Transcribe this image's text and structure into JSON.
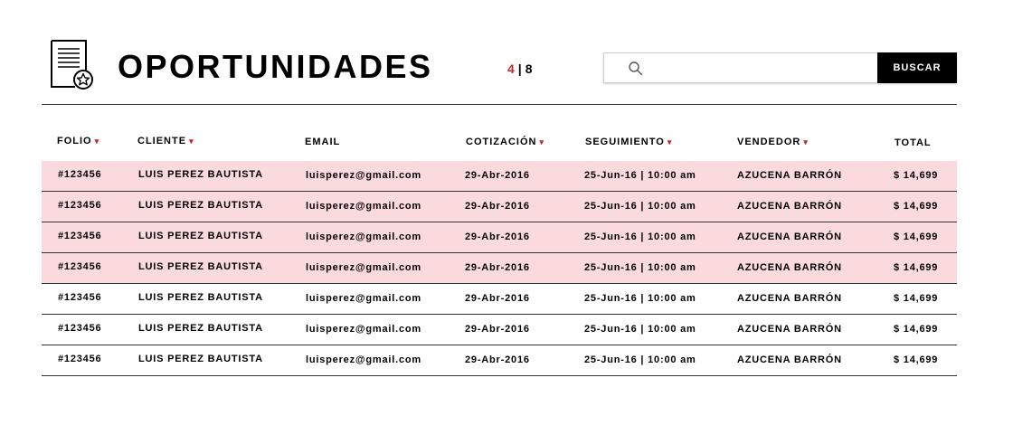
{
  "header": {
    "title": "OPORTUNIDADES",
    "pager": {
      "current": "4",
      "separator": "|",
      "total": "8"
    }
  },
  "search": {
    "placeholder": "",
    "value": "",
    "button_label": "BUSCAR"
  },
  "table": {
    "columns": [
      {
        "key": "folio",
        "label": "FOLIO",
        "sortable": true
      },
      {
        "key": "cliente",
        "label": "CLIENTE",
        "sortable": true
      },
      {
        "key": "email",
        "label": "EMAIL",
        "sortable": false
      },
      {
        "key": "cotizacion",
        "label": "COTIZACIÓN",
        "sortable": true
      },
      {
        "key": "seguimiento",
        "label": "SEGUIMIENTO",
        "sortable": true
      },
      {
        "key": "vendedor",
        "label": "VENDEDOR",
        "sortable": true
      },
      {
        "key": "total",
        "label": "TOTAL",
        "sortable": false
      }
    ],
    "sort_indicator": "▾",
    "rows": [
      {
        "highlighted": true,
        "folio": "#123456",
        "cliente": "LUIS PEREZ BAUTISTA",
        "email": "luisperez@gmail.com",
        "cotizacion": "29-Abr-2016",
        "seguimiento": "25-Jun-16 | 10:00 am",
        "vendedor": "AZUCENA BARRÓN",
        "total": "$ 14,699"
      },
      {
        "highlighted": true,
        "folio": "#123456",
        "cliente": "LUIS PEREZ BAUTISTA",
        "email": "luisperez@gmail.com",
        "cotizacion": "29-Abr-2016",
        "seguimiento": "25-Jun-16 | 10:00 am",
        "vendedor": "AZUCENA BARRÓN",
        "total": "$ 14,699"
      },
      {
        "highlighted": true,
        "folio": "#123456",
        "cliente": "LUIS PEREZ BAUTISTA",
        "email": "luisperez@gmail.com",
        "cotizacion": "29-Abr-2016",
        "seguimiento": "25-Jun-16 | 10:00 am",
        "vendedor": "AZUCENA BARRÓN",
        "total": "$ 14,699"
      },
      {
        "highlighted": true,
        "folio": "#123456",
        "cliente": "LUIS PEREZ BAUTISTA",
        "email": "luisperez@gmail.com",
        "cotizacion": "29-Abr-2016",
        "seguimiento": "25-Jun-16 | 10:00 am",
        "vendedor": "AZUCENA BARRÓN",
        "total": "$ 14,699"
      },
      {
        "highlighted": false,
        "folio": "#123456",
        "cliente": "LUIS PEREZ BAUTISTA",
        "email": "luisperez@gmail.com",
        "cotizacion": "29-Abr-2016",
        "seguimiento": "25-Jun-16 | 10:00 am",
        "vendedor": "AZUCENA BARRÓN",
        "total": "$ 14,699"
      },
      {
        "highlighted": false,
        "folio": "#123456",
        "cliente": "LUIS PEREZ BAUTISTA",
        "email": "luisperez@gmail.com",
        "cotizacion": "29-Abr-2016",
        "seguimiento": "25-Jun-16 | 10:00 am",
        "vendedor": "AZUCENA BARRÓN",
        "total": "$ 14,699"
      },
      {
        "highlighted": false,
        "folio": "#123456",
        "cliente": "LUIS PEREZ BAUTISTA",
        "email": "luisperez@gmail.com",
        "cotizacion": "29-Abr-2016",
        "seguimiento": "25-Jun-16 | 10:00 am",
        "vendedor": "AZUCENA BARRÓN",
        "total": "$ 14,699"
      }
    ]
  },
  "colors": {
    "accent": "#c1272d",
    "highlight_row": "#fadadd",
    "button_bg": "#000000",
    "text": "#000000"
  },
  "icons": {
    "header": "certificate-document-icon",
    "search": "search-icon",
    "sort": "caret-down-icon"
  }
}
